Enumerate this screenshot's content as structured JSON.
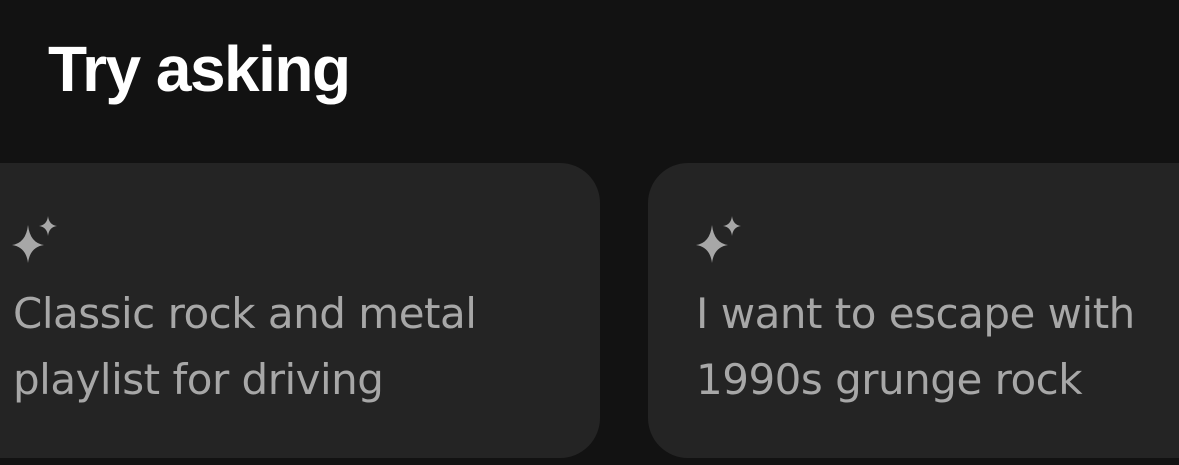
{
  "section": {
    "title": "Try asking"
  },
  "prompts": [
    {
      "icon": "sparkle-icon",
      "text": "Classic rock and metal playlist for driving"
    },
    {
      "icon": "sparkle-icon",
      "text": "I want to escape with 1990s grunge rock"
    }
  ],
  "colors": {
    "background": "#121212",
    "card": "#242424",
    "title": "#ffffff",
    "prompt_text": "#a7a7a7",
    "icon": "#a7a7a7"
  }
}
